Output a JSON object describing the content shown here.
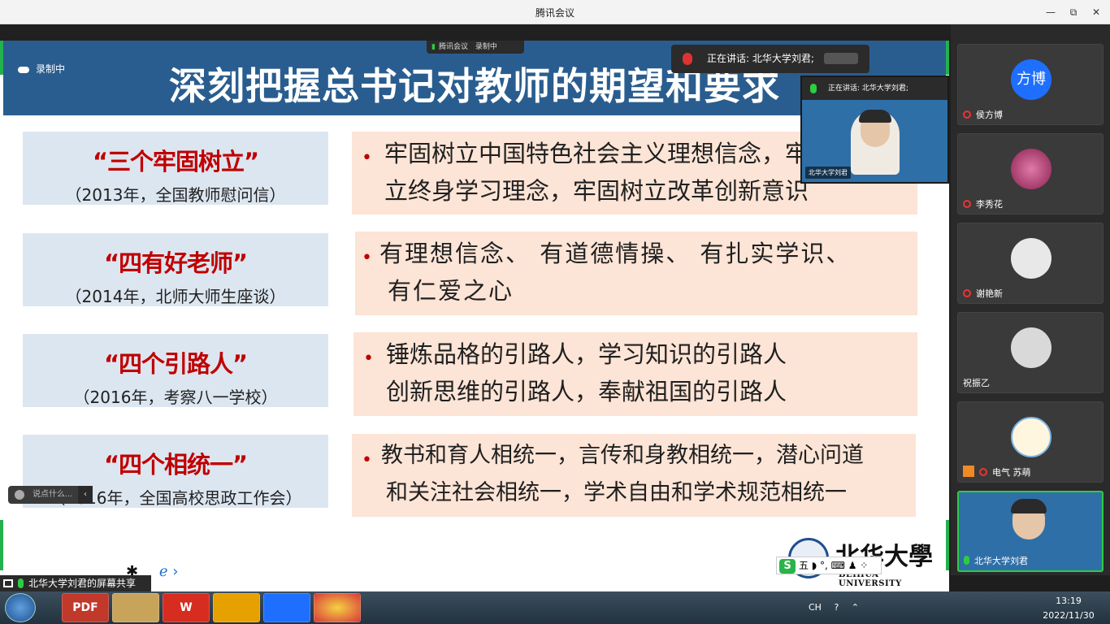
{
  "window": {
    "title": "腾讯会议",
    "controls": {
      "minimize": "—",
      "restore": "⧉",
      "close": "✕"
    }
  },
  "slide": {
    "title": "深刻把握总书记对教师的期望和要求",
    "rec_label": "录制中",
    "top_pill": {
      "app": "腾讯会议",
      "rec": "录制中"
    },
    "rows": [
      {
        "heading": "“三个牢固树立”",
        "sub": "（2013年，全国教师慰问信）",
        "line1": "牢固树立中国特色社会主义理想信念，牢固树",
        "line2": "立终身学习理念，牢固树立改革创新意识"
      },
      {
        "heading": "“四有好老师”",
        "sub": "（2014年，北师大师生座谈）",
        "line1": "有理想信念、 有道德情操、 有扎实学识、",
        "line2": "有仁爱之心"
      },
      {
        "heading": "“四个引路人”",
        "sub": "（2016年，考察八一学校）",
        "line1": "锤炼品格的引路人，学习知识的引路人",
        "line2": "创新思维的引路人，奉献祖国的引路人"
      },
      {
        "heading": "“四个相统一”",
        "sub": "（2016年，全国高校思政工作会）",
        "line1": "教书和育人相统一，言传和身教相统一，潜心问道",
        "line2": "和关注社会相统一，学术自由和学术规范相统一"
      }
    ],
    "logo": {
      "cn": "北华大學",
      "en": "BEIHUA UNIVERSITY"
    },
    "ime": {
      "s": "S",
      "items": "五 ◗ °, ⌨ ♟ ⁘"
    },
    "chat_placeholder": "说点什么...",
    "bottom_icons": [
      "✱",
      "ℯ ›"
    ]
  },
  "speaking": {
    "banner_text": "正在讲话: 北华大学刘君;",
    "video_top_text": "正在讲话: 北华大学刘君;",
    "video_name": "北华大学刘君"
  },
  "participants": [
    {
      "name": "侯方博",
      "avatar_text": "方博",
      "avatar_color": "#1e6fff",
      "muted": true
    },
    {
      "name": "李秀花",
      "avatar_text": "",
      "avatar_color": "#c0508a",
      "muted": true
    },
    {
      "name": "谢艳新",
      "avatar_text": "",
      "avatar_color": "#e8e8e8",
      "muted": true
    },
    {
      "name": "祝振乙",
      "avatar_text": "",
      "avatar_color": "#d9d9d9",
      "muted": false
    },
    {
      "name": "电气 苏萌",
      "avatar_text": "",
      "avatar_color": "#fff6e0",
      "muted": true
    },
    {
      "name": "北华大学刘君",
      "avatar_text": "",
      "avatar_color": "#2f6fa8",
      "muted": false
    }
  ],
  "share_bar": {
    "text": "北华大学刘君的屏幕共享"
  },
  "taskbar": {
    "apps": [
      "PDF",
      "",
      "W",
      "",
      "",
      ""
    ],
    "tray": [
      "CH",
      "?",
      "⌃"
    ],
    "time": "13:19",
    "date": "2022/11/30"
  }
}
